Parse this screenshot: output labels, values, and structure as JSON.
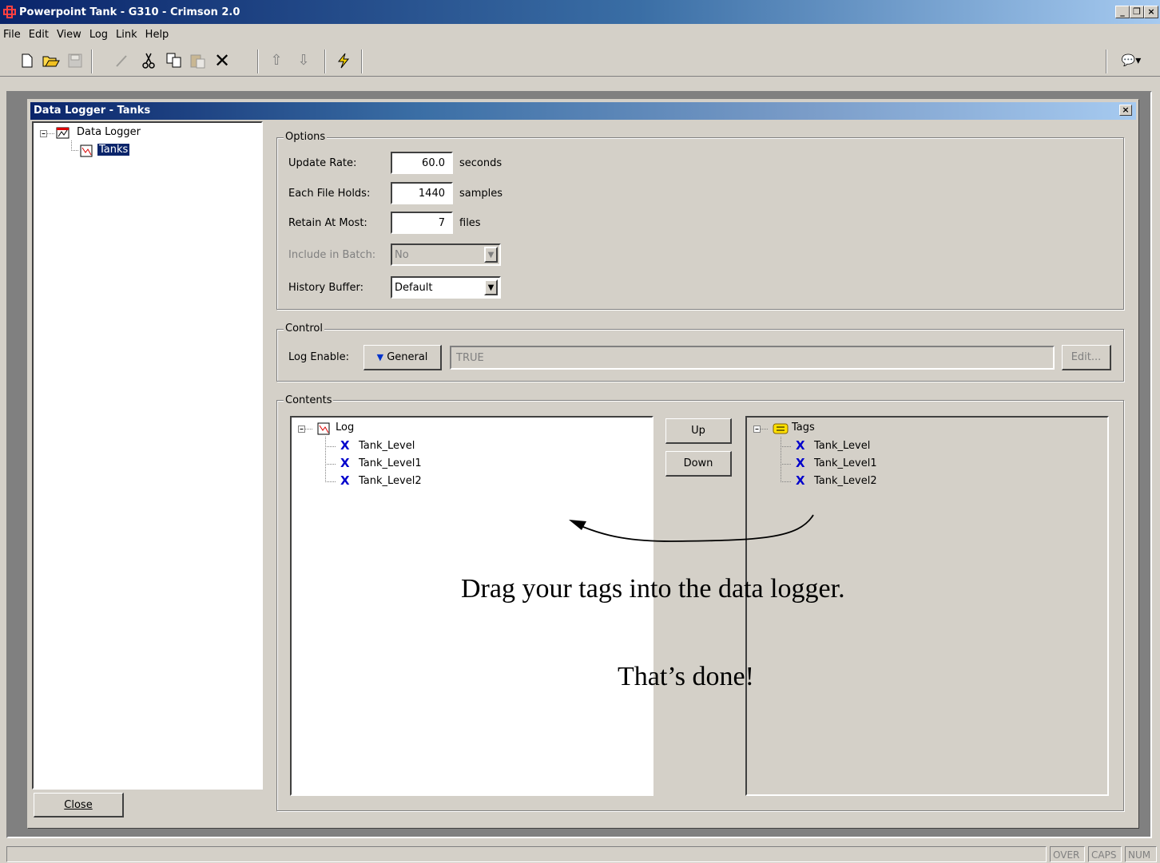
{
  "window": {
    "title": "Powerpoint Tank - G310 - Crimson 2.0",
    "minimize": "_",
    "restore": "❐",
    "close": "×"
  },
  "menu": [
    "File",
    "Edit",
    "View",
    "Log",
    "Link",
    "Help"
  ],
  "toolbar": {
    "buttons": [
      "new-icon",
      "open-icon",
      "save-icon",
      "edit-icon",
      "cut-icon",
      "copy-icon",
      "paste-icon",
      "delete-icon",
      "move-up-icon",
      "move-down-icon",
      "download-icon",
      "balloon-icon"
    ]
  },
  "child_window": {
    "title": "Data Logger - Tanks",
    "close": "×"
  },
  "left_tree": {
    "root": "Data Logger",
    "child": "Tanks"
  },
  "options": {
    "group_label": "Options",
    "update_rate": {
      "label": "Update Rate:",
      "value": "60.0",
      "unit": "seconds"
    },
    "each_file_holds": {
      "label": "Each File Holds:",
      "value": "1440",
      "unit": "samples"
    },
    "retain_at_most": {
      "label": "Retain At Most:",
      "value": "7",
      "unit": "files"
    },
    "include_in_batch": {
      "label": "Include in Batch:",
      "value": "No"
    },
    "history_buffer": {
      "label": "History Buffer:",
      "value": "Default"
    }
  },
  "control": {
    "group_label": "Control",
    "log_enable_label": "Log Enable:",
    "mode_button": "General",
    "expression": "TRUE",
    "edit_button": "Edit..."
  },
  "contents": {
    "group_label": "Contents",
    "log_root": "Log",
    "log_items": [
      "Tank_Level",
      "Tank_Level1",
      "Tank_Level2"
    ],
    "up_button": "Up",
    "down_button": "Down",
    "tags_root": "Tags",
    "tag_items": [
      "Tank_Level",
      "Tank_Level1",
      "Tank_Level2"
    ]
  },
  "annotation": {
    "line1": "Drag your tags into the data logger.",
    "line2": "That’s done!"
  },
  "close_button": "Close",
  "status": [
    "OVER",
    "CAPS",
    "NUM"
  ]
}
